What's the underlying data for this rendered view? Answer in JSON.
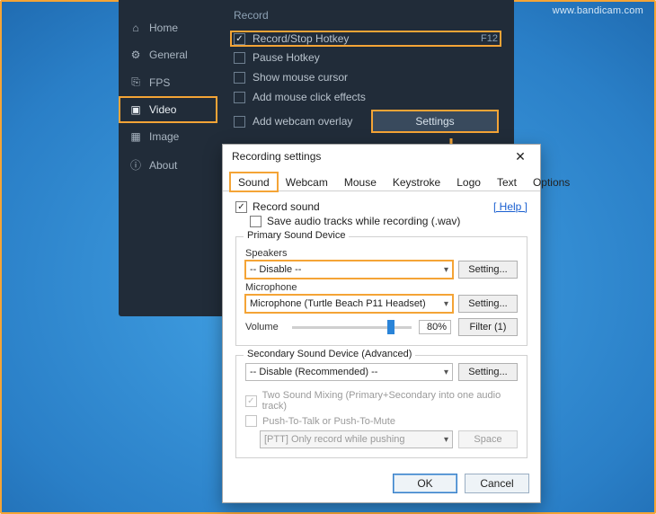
{
  "watermark": "www.bandicam.com",
  "sidebar": {
    "items": [
      {
        "label": "Home",
        "icon": "⌂"
      },
      {
        "label": "General",
        "icon": "⚙"
      },
      {
        "label": "FPS",
        "icon": "⎘"
      },
      {
        "label": "Video",
        "icon": "▣"
      },
      {
        "label": "Image",
        "icon": "▦"
      },
      {
        "label": "About",
        "icon": "ⓘ"
      }
    ]
  },
  "record_panel": {
    "title": "Record",
    "items": [
      {
        "label": "Record/Stop Hotkey",
        "checked": true,
        "value": "F12"
      },
      {
        "label": "Pause Hotkey",
        "checked": false,
        "value": ""
      },
      {
        "label": "Show mouse cursor",
        "checked": false
      },
      {
        "label": "Add mouse click effects",
        "checked": false
      },
      {
        "label": "Add webcam overlay",
        "checked": false
      }
    ],
    "settings_btn": "Settings"
  },
  "dialog": {
    "title": "Recording settings",
    "tabs": [
      "Sound",
      "Webcam",
      "Mouse",
      "Keystroke",
      "Logo",
      "Text",
      "Options"
    ],
    "record_sound": {
      "label": "Record sound",
      "checked": true
    },
    "save_wav": {
      "label": "Save audio tracks while recording (.wav)",
      "checked": false
    },
    "help": "[ Help ]",
    "primary": {
      "legend": "Primary Sound Device",
      "speakers_label": "Speakers",
      "speakers_value": "-- Disable --",
      "mic_label": "Microphone",
      "mic_value": "Microphone (Turtle Beach P11 Headset)",
      "setting_btn": "Setting...",
      "volume_label": "Volume",
      "volume_pct": "80%",
      "filter_btn": "Filter (1)"
    },
    "secondary": {
      "legend": "Secondary Sound Device (Advanced)",
      "value": "-- Disable (Recommended) --",
      "setting_btn": "Setting...",
      "mix_label": "Two Sound Mixing (Primary+Secondary into one audio track)",
      "ptt_label": "Push-To-Talk or Push-To-Mute",
      "ptt_mode": "[PTT] Only record while pushing",
      "ptt_key": "Space"
    },
    "ok": "OK",
    "cancel": "Cancel"
  }
}
